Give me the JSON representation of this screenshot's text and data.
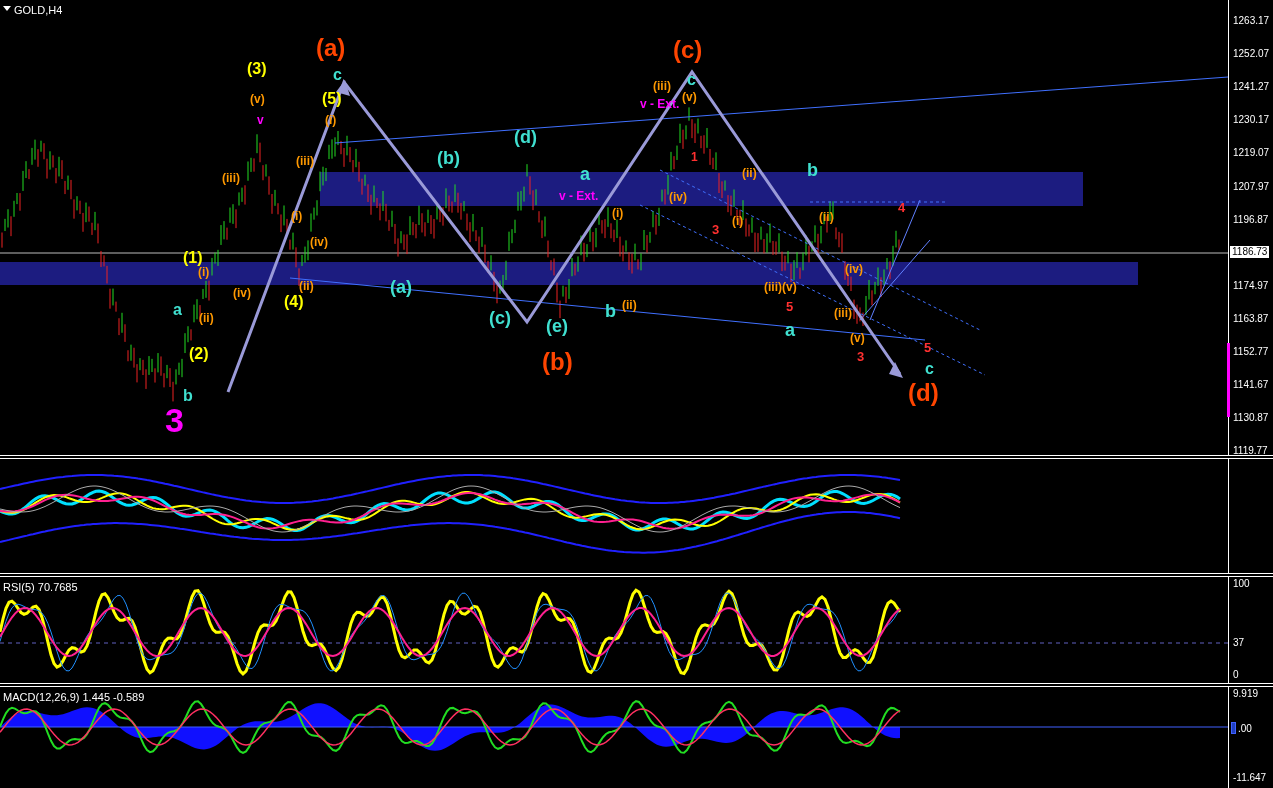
{
  "chart": {
    "title": "GOLD,H4",
    "current_price": "1186.73",
    "price_axis": [
      "1263.17",
      "1252.07",
      "1241.27",
      "1230.17",
      "1219.07",
      "1207.97",
      "1196.87",
      "1174.97",
      "1163.87",
      "1152.77",
      "1141.67",
      "1130.87",
      "1119.77"
    ],
    "wave_labels": [
      {
        "text": "(a)",
        "color": "#ff4500"
      },
      {
        "text": "c",
        "color": "#40e0d0"
      },
      {
        "text": "(5)",
        "color": "#ffff00"
      },
      {
        "text": "(3)",
        "color": "#ffff00"
      },
      {
        "text": "(v)",
        "color": "#ff9900"
      },
      {
        "text": "v",
        "color": "#ff00ff"
      },
      {
        "text": "(iii)",
        "color": "#ff9900"
      },
      {
        "text": "(iii)",
        "color": "#ff9900"
      },
      {
        "text": "(i)",
        "color": "#ff9900"
      },
      {
        "text": "(i)",
        "color": "#ff9900"
      },
      {
        "text": "(iv)",
        "color": "#ff9900"
      },
      {
        "text": "(1)",
        "color": "#ffff00"
      },
      {
        "text": "(i)",
        "color": "#ff9900"
      },
      {
        "text": "(iv)",
        "color": "#ff9900"
      },
      {
        "text": "(4)",
        "color": "#ffff00"
      },
      {
        "text": "(ii)",
        "color": "#ff9900"
      },
      {
        "text": "(ii)",
        "color": "#ff9900"
      },
      {
        "text": "a",
        "color": "#40e0d0"
      },
      {
        "text": "(2)",
        "color": "#ffff00"
      },
      {
        "text": "b",
        "color": "#40e0d0"
      },
      {
        "text": "3",
        "color": "#ff00ff"
      },
      {
        "text": "(b)",
        "color": "#40e0d0"
      },
      {
        "text": "(d)",
        "color": "#40e0d0"
      },
      {
        "text": "(a)",
        "color": "#40e0d0"
      },
      {
        "text": "(c)",
        "color": "#40e0d0"
      },
      {
        "text": "(e)",
        "color": "#40e0d0"
      },
      {
        "text": "(b)",
        "color": "#ff4500"
      },
      {
        "text": "a",
        "color": "#40e0d0"
      },
      {
        "text": "v - Ext.",
        "color": "#ff00ff"
      },
      {
        "text": "b",
        "color": "#40e0d0"
      },
      {
        "text": "(i)",
        "color": "#ff9900"
      },
      {
        "text": "(ii)",
        "color": "#ff9900"
      },
      {
        "text": "(c)",
        "color": "#ff4500"
      },
      {
        "text": "c",
        "color": "#40e0d0"
      },
      {
        "text": "(iii)",
        "color": "#ff9900"
      },
      {
        "text": "(v)",
        "color": "#ff9900"
      },
      {
        "text": "v - Ext.",
        "color": "#ff00ff"
      },
      {
        "text": "1",
        "color": "#ff3030"
      },
      {
        "text": "(iv)",
        "color": "#ff9900"
      },
      {
        "text": "3",
        "color": "#ff3030"
      },
      {
        "text": "(ii)",
        "color": "#ff9900"
      },
      {
        "text": "(i)",
        "color": "#ff9900"
      },
      {
        "text": "b",
        "color": "#40e0d0"
      },
      {
        "text": "(iii)(v)",
        "color": "#ff9900"
      },
      {
        "text": "5",
        "color": "#ff3030"
      },
      {
        "text": "a",
        "color": "#40e0d0"
      },
      {
        "text": "(ii)",
        "color": "#ff9900"
      },
      {
        "text": "(iv)",
        "color": "#ff9900"
      },
      {
        "text": "(iii)",
        "color": "#ff9900"
      },
      {
        "text": "(v)",
        "color": "#ff9900"
      },
      {
        "text": "3",
        "color": "#ff3030"
      },
      {
        "text": "4",
        "color": "#ff3030"
      },
      {
        "text": "5",
        "color": "#ff3030"
      },
      {
        "text": "c",
        "color": "#40e0d0"
      },
      {
        "text": "(d)",
        "color": "#ff4500"
      }
    ]
  },
  "rsi": {
    "label": "RSI(5) 70.7685",
    "axis": [
      "100",
      "37",
      "0"
    ]
  },
  "macd": {
    "label": "MACD(12,26,9) 1.445 -0.589",
    "axis": [
      "9.919",
      ".00",
      "-11.647"
    ]
  }
}
